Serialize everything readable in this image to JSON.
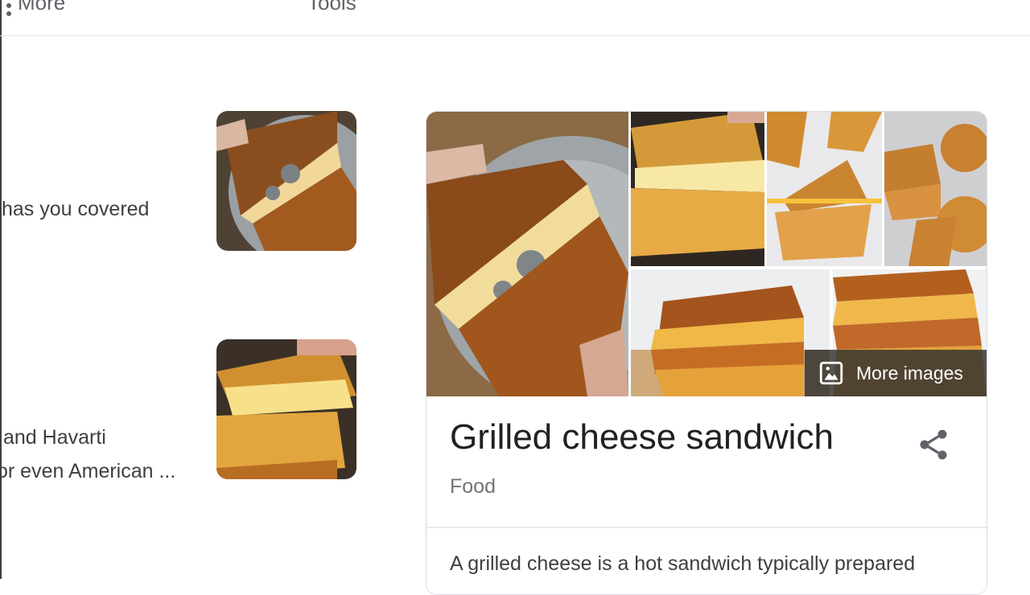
{
  "toolbar": {
    "more_label": "More",
    "tools_label": "Tools"
  },
  "results": [
    {
      "snippet_line1": "has you covered"
    },
    {
      "snippet_line1": "and Havarti",
      "snippet_line2": "or even American ..."
    }
  ],
  "knowledge_panel": {
    "title": "Grilled cheese sandwich",
    "category": "Food",
    "more_images_label": "More images",
    "description_start": "A grilled cheese is a hot sandwich typically prepared"
  },
  "icons": {
    "share": "share-icon",
    "image": "image-icon",
    "more": "more-vert-icon"
  }
}
